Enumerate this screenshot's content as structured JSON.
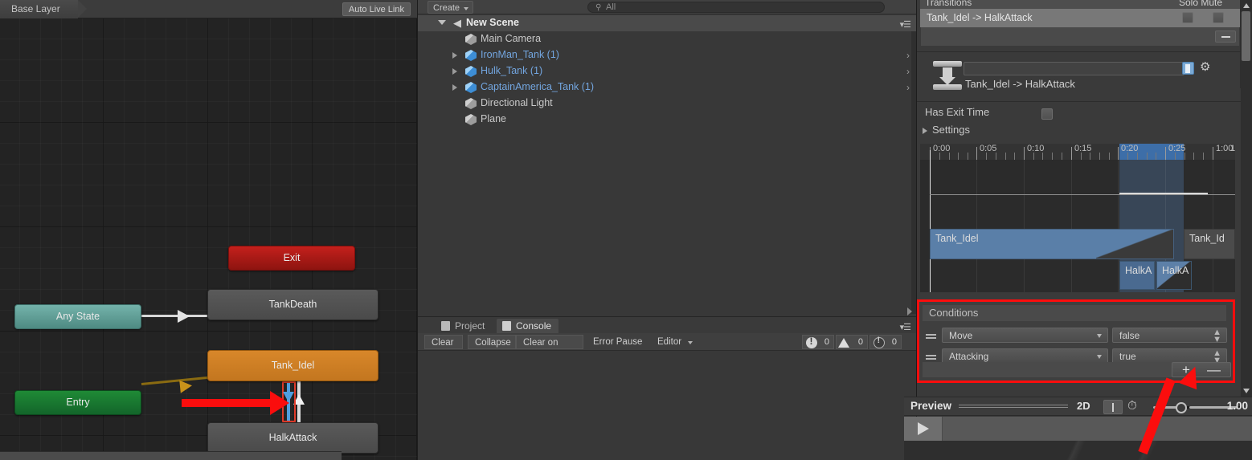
{
  "animator": {
    "breadcrumb": "Base Layer",
    "auto_live_link": "Auto Live Link",
    "nodes": [
      {
        "id": "exit",
        "label": "Exit",
        "color": "#b81c18"
      },
      {
        "id": "tank_death",
        "label": "TankDeath",
        "color": "#515151"
      },
      {
        "id": "any_state",
        "label": "Any State",
        "color": "#5d9c94"
      },
      {
        "id": "tank_idel",
        "label": "Tank_Idel",
        "color": "#cd7d24"
      },
      {
        "id": "entry",
        "label": "Entry",
        "color": "#19762f"
      },
      {
        "id": "halk_attack",
        "label": "HalkAttack",
        "color": "#515151"
      }
    ]
  },
  "hierarchy": {
    "create_label": "Create",
    "search_placeholder": "All",
    "search_value": "All",
    "scene_name": "New Scene",
    "items": [
      {
        "label": "Main Camera",
        "prefab": false,
        "expandable": false
      },
      {
        "label": "IronMan_Tank (1)",
        "prefab": true,
        "expandable": true
      },
      {
        "label": "Hulk_Tank (1)",
        "prefab": true,
        "expandable": true
      },
      {
        "label": "CaptainAmerica_Tank (1)",
        "prefab": true,
        "expandable": true
      },
      {
        "label": "Directional Light",
        "prefab": false,
        "expandable": false
      },
      {
        "label": "Plane",
        "prefab": false,
        "expandable": false
      }
    ]
  },
  "console": {
    "tabs": [
      {
        "label": "Project",
        "active": false
      },
      {
        "label": "Console",
        "active": true
      }
    ],
    "toolbar": {
      "clear": "Clear",
      "collapse": "Collapse",
      "clear_on_play": "Clear on Play",
      "error_pause": "Error Pause",
      "editor": "Editor"
    },
    "counts": {
      "errors": "0",
      "warnings": "0",
      "infos": "0"
    }
  },
  "inspector": {
    "transitions_header": "Transitions",
    "solo_mute_header": "Solo  Mute",
    "transition_row_label": "Tank_Idel -> HalkAttack",
    "transition_name_value": "",
    "transition_subname": "Tank_Idel -> HalkAttack",
    "has_exit_time_label": "Has Exit Time",
    "has_exit_time_checked": false,
    "settings_label": "Settings",
    "timeline": {
      "tick_labels": [
        "0:00",
        "0:05",
        "0:10",
        "0:15",
        "0:20",
        "0:25",
        "1:00",
        "1"
      ],
      "clips": [
        {
          "label": "Tank_Idel"
        },
        {
          "label": "Tank_Id"
        },
        {
          "label": "HalkA"
        },
        {
          "label": "HalkA"
        }
      ]
    },
    "conditions": {
      "title": "Conditions",
      "rows": [
        {
          "parameter": "Move",
          "value": "false"
        },
        {
          "parameter": "Attacking",
          "value": "true"
        }
      ],
      "add_label": "+",
      "remove_label": "—",
      "highlight_color": "#fb0d0d"
    },
    "preview": {
      "label": "Preview",
      "mode_2d": "2D",
      "speed_value": "1.00"
    }
  }
}
